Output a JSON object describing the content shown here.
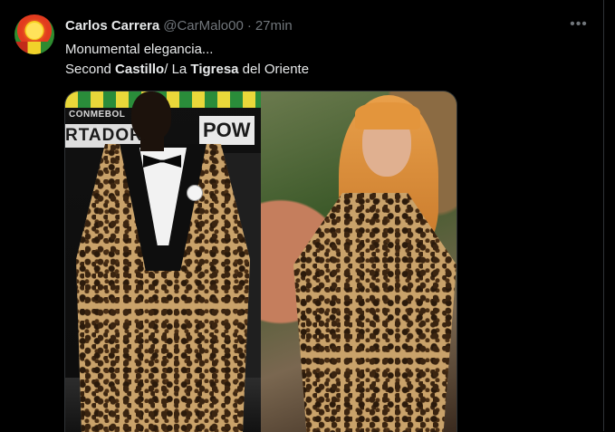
{
  "tweet": {
    "author_name": "Carlos Carrera",
    "handle": "@CarMalo00",
    "separator": "·",
    "time": "27min",
    "more_icon": "more-horizontal-icon",
    "text": {
      "line1": "Monumental elegancia...",
      "line2_prefix": "Second ",
      "line2_bold1": "Castillo",
      "line2_mid": "/ La ",
      "line2_bold2": "Tigresa",
      "line2_suffix": " del Oriente"
    }
  },
  "media": {
    "left_photo": {
      "banner_text": "CONMEBOL",
      "sign_left": "RTADOR",
      "sign_right": "POW"
    }
  }
}
